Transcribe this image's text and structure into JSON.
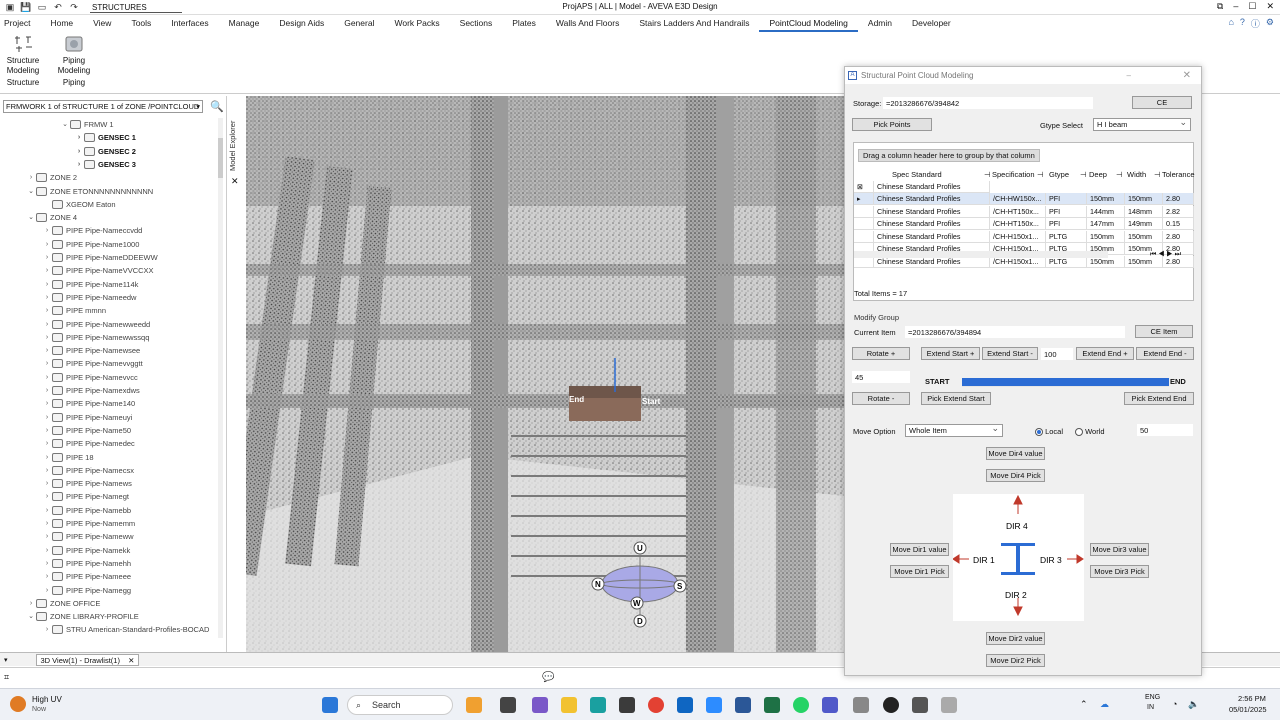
{
  "titlebar": {
    "combo_value": "STRUCTURES",
    "title": "ProjAPS | ALL | Model - AVEVA E3D Design"
  },
  "menu": [
    "Project",
    "Home",
    "View",
    "Tools",
    "Interfaces",
    "Manage",
    "Design Aids",
    "General",
    "Work Packs",
    "Sections",
    "Plates",
    "Walls And Floors",
    "Stairs Ladders And Handrails",
    "PointCloud Modeling",
    "Admin",
    "Developer"
  ],
  "menu_active": "PointCloud Modeling",
  "ribbon": {
    "buttons": [
      {
        "label1": "Structure",
        "label2": "Modeling",
        "group": "Structure",
        "icon": "structure-icon"
      },
      {
        "label1": "Piping",
        "label2": "Modeling",
        "group": "Piping",
        "icon": "piping-icon"
      }
    ]
  },
  "explorer": {
    "combo": "FRMWORK 1 of STRUCTURE 1 of ZONE /POINTCLOUD",
    "tab_label": "Model Explorer",
    "tree": [
      {
        "indent": 60,
        "arrow": "⌄",
        "label": "FRMW 1",
        "bold": false,
        "color": "#444"
      },
      {
        "indent": 74,
        "arrow": "›",
        "label": "GENSEC 1",
        "bold": true,
        "color": "#111"
      },
      {
        "indent": 74,
        "arrow": "›",
        "label": "GENSEC 2",
        "bold": true,
        "color": "#111"
      },
      {
        "indent": 74,
        "arrow": "›",
        "label": "GENSEC 3",
        "bold": true,
        "color": "#111"
      },
      {
        "indent": 26,
        "arrow": "›",
        "label": "ZONE 2",
        "bold": false,
        "color": "#444"
      },
      {
        "indent": 26,
        "arrow": "⌄",
        "label": "ZONE ETONNNNNNNNNNNN",
        "bold": false,
        "color": "#444"
      },
      {
        "indent": 42,
        "arrow": "",
        "label": "XGEOM Eaton",
        "bold": false,
        "color": "#444"
      },
      {
        "indent": 26,
        "arrow": "⌄",
        "label": "ZONE 4",
        "bold": false,
        "color": "#444"
      },
      {
        "indent": 42,
        "arrow": "›",
        "label": "PIPE Pipe-Nameccvdd",
        "bold": false,
        "color": "#444"
      },
      {
        "indent": 42,
        "arrow": "›",
        "label": "PIPE Pipe-Name1000",
        "bold": false,
        "color": "#444"
      },
      {
        "indent": 42,
        "arrow": "›",
        "label": "PIPE Pipe-NameDDEEWW",
        "bold": false,
        "color": "#444"
      },
      {
        "indent": 42,
        "arrow": "›",
        "label": "PIPE Pipe-NameVVCCXX",
        "bold": false,
        "color": "#444"
      },
      {
        "indent": 42,
        "arrow": "›",
        "label": "PIPE Pipe-Name114k",
        "bold": false,
        "color": "#444"
      },
      {
        "indent": 42,
        "arrow": "›",
        "label": "PIPE Pipe-Nameedw",
        "bold": false,
        "color": "#444"
      },
      {
        "indent": 42,
        "arrow": "›",
        "label": "PIPE mmnn",
        "bold": false,
        "color": "#444"
      },
      {
        "indent": 42,
        "arrow": "›",
        "label": "PIPE Pipe-Namewweedd",
        "bold": false,
        "color": "#444"
      },
      {
        "indent": 42,
        "arrow": "›",
        "label": "PIPE Pipe-Namewwssqq",
        "bold": false,
        "color": "#444"
      },
      {
        "indent": 42,
        "arrow": "›",
        "label": "PIPE Pipe-Namewsee",
        "bold": false,
        "color": "#444"
      },
      {
        "indent": 42,
        "arrow": "›",
        "label": "PIPE Pipe-Namevvggtt",
        "bold": false,
        "color": "#444"
      },
      {
        "indent": 42,
        "arrow": "›",
        "label": "PIPE Pipe-Namevvcc",
        "bold": false,
        "color": "#444"
      },
      {
        "indent": 42,
        "arrow": "›",
        "label": "PIPE Pipe-Namexdws",
        "bold": false,
        "color": "#444"
      },
      {
        "indent": 42,
        "arrow": "›",
        "label": "PIPE Pipe-Name140",
        "bold": false,
        "color": "#444"
      },
      {
        "indent": 42,
        "arrow": "›",
        "label": "PIPE Pipe-Nameuyi",
        "bold": false,
        "color": "#444"
      },
      {
        "indent": 42,
        "arrow": "›",
        "label": "PIPE Pipe-Name50",
        "bold": false,
        "color": "#444"
      },
      {
        "indent": 42,
        "arrow": "›",
        "label": "PIPE Pipe-Namedec",
        "bold": false,
        "color": "#444"
      },
      {
        "indent": 42,
        "arrow": "›",
        "label": "PIPE 18",
        "bold": false,
        "color": "#444"
      },
      {
        "indent": 42,
        "arrow": "›",
        "label": "PIPE Pipe-Namecsx",
        "bold": false,
        "color": "#444"
      },
      {
        "indent": 42,
        "arrow": "›",
        "label": "PIPE Pipe-Namews",
        "bold": false,
        "color": "#444"
      },
      {
        "indent": 42,
        "arrow": "›",
        "label": "PIPE Pipe-Namegt",
        "bold": false,
        "color": "#444"
      },
      {
        "indent": 42,
        "arrow": "›",
        "label": "PIPE Pipe-Namebb",
        "bold": false,
        "color": "#444"
      },
      {
        "indent": 42,
        "arrow": "›",
        "label": "PIPE Pipe-Namemm",
        "bold": false,
        "color": "#444"
      },
      {
        "indent": 42,
        "arrow": "›",
        "label": "PIPE Pipe-Nameww",
        "bold": false,
        "color": "#444"
      },
      {
        "indent": 42,
        "arrow": "›",
        "label": "PIPE Pipe-Namekk",
        "bold": false,
        "color": "#444"
      },
      {
        "indent": 42,
        "arrow": "›",
        "label": "PIPE Pipe-Namehh",
        "bold": false,
        "color": "#444"
      },
      {
        "indent": 42,
        "arrow": "›",
        "label": "PIPE Pipe-Nameee",
        "bold": false,
        "color": "#444"
      },
      {
        "indent": 42,
        "arrow": "›",
        "label": "PIPE Pipe-Namegg",
        "bold": false,
        "color": "#444"
      },
      {
        "indent": 26,
        "arrow": "›",
        "label": "ZONE OFFICE",
        "bold": false,
        "color": "#444"
      },
      {
        "indent": 26,
        "arrow": "⌄",
        "label": "ZONE LIBRARY-PROFILE",
        "bold": false,
        "color": "#444"
      },
      {
        "indent": 42,
        "arrow": "›",
        "label": "STRU American-Standard-Profiles-BOCAD",
        "bold": false,
        "color": "#444"
      }
    ]
  },
  "viewport": {
    "end_label": "End",
    "start_label": "Start",
    "gizmo": {
      "u": "U",
      "n": "N",
      "s": "S",
      "w": "W",
      "d": "D"
    }
  },
  "statusbar": {
    "view_tab": "3D View(1) - Drawlist(1)"
  },
  "dialog": {
    "title": "Structural Point Cloud Modeling",
    "storage_label": "Storage:",
    "storage_value": "=2013286676/394842",
    "ce_button": "CE",
    "pick_points": "Pick Points",
    "gtype_select_label": "Gtype Select",
    "gtype_select_value": "H I beam",
    "group_hint": "Drag a column header here to group by that column",
    "columns": [
      "Spec Standard",
      "Specification",
      "Gtype",
      "Deep",
      "Width",
      "Tolerance"
    ],
    "filter_row": "Chinese Standard Profiles",
    "rows": [
      [
        "Chinese Standard Profiles",
        "/CH-HW150x...",
        "PFI",
        "150mm",
        "150mm",
        "2.80"
      ],
      [
        "Chinese Standard Profiles",
        "/CH-HT150x...",
        "PFI",
        "144mm",
        "148mm",
        "2.82"
      ],
      [
        "Chinese Standard Profiles",
        "/CH-HT150x...",
        "PFI",
        "147mm",
        "149mm",
        "0.15"
      ],
      [
        "Chinese Standard Profiles",
        "/CH-H150x1...",
        "PLTG",
        "150mm",
        "150mm",
        "2.80"
      ],
      [
        "Chinese Standard Profiles",
        "/CH-H150x1...",
        "PLTG",
        "150mm",
        "150mm",
        "2.80"
      ],
      [
        "Chinese Standard Profiles",
        "/CH-H150x1...",
        "PLTG",
        "150mm",
        "150mm",
        "2.80"
      ]
    ],
    "total_items": "Total Items = 17",
    "modify_group": "Modify Group",
    "current_item_label": "Current Item",
    "current_item_value": "=2013286676/394894",
    "ce_item_button": "CE Item",
    "rotate_plus": "Rotate +",
    "extend_start_plus": "Extend Start +",
    "extend_start_minus": "Extend Start -",
    "extend_value": "100",
    "extend_end_plus": "Extend End +",
    "extend_end_minus": "Extend End -",
    "rotate_value": "45",
    "start_label": "START",
    "end_label": "END",
    "progress": 1.0,
    "rotate_minus": "Rotate -",
    "pick_extend_start": "Pick Extend Start",
    "pick_extend_end": "Pick Extend End",
    "move_option_label": "Move Option",
    "move_option_value": "Whole Item",
    "radio_local": "Local",
    "radio_world": "World",
    "move_value": "50",
    "move_dir4_value": "Move Dir4 value",
    "move_dir4_pick": "Move Dir4 Pick",
    "move_dir1_value": "Move Dir1 value",
    "move_dir1_pick": "Move Dir1 Pick",
    "move_dir3_value": "Move Dir3 value",
    "move_dir3_pick": "Move Dir3 Pick",
    "move_dir2_value": "Move Dir2 value",
    "move_dir2_pick": "Move Dir2 Pick",
    "dir4": "DIR 4",
    "dir1": "DIR 1",
    "dir3": "DIR 3",
    "dir2": "DIR 2"
  },
  "taskbar": {
    "weather_title": "High UV",
    "weather_sub": "Now",
    "search": "Search",
    "lang1": "ENG",
    "lang2": "IN",
    "time": "2:56 PM",
    "date": "05/01/2025"
  },
  "colors": {
    "accent": "#2b6cd4",
    "arrow_red": "#c0392b",
    "member": "#8a6a5a"
  }
}
